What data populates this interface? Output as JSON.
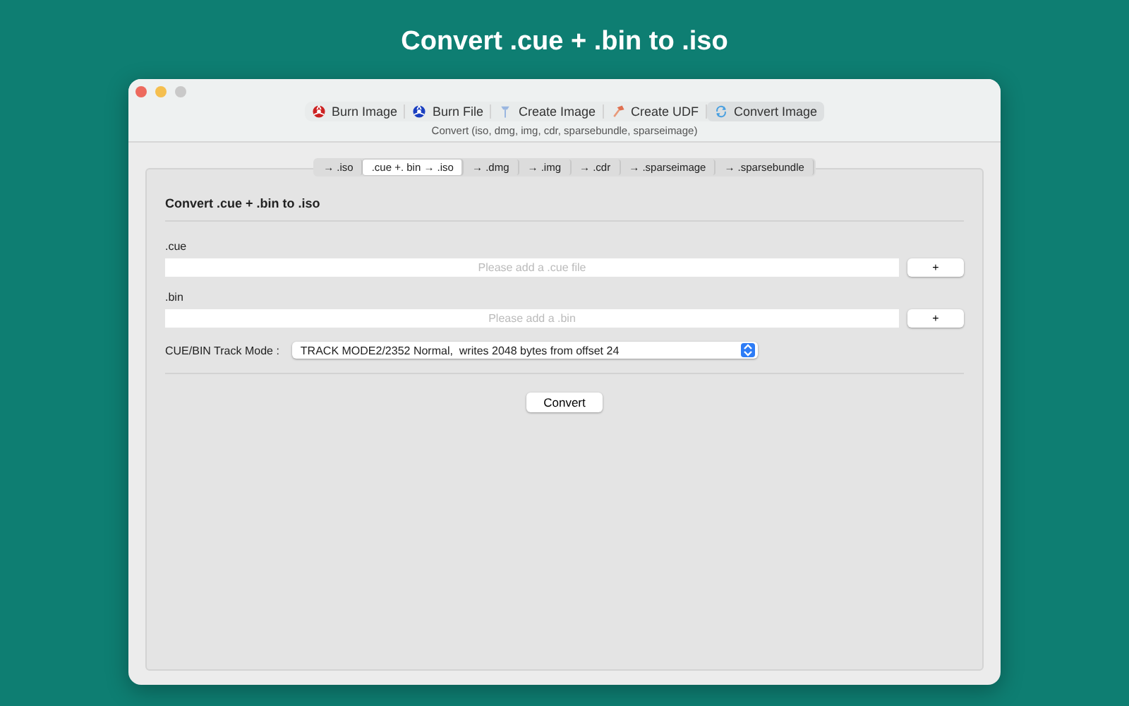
{
  "headline": "Convert .cue + .bin to .iso",
  "window": {
    "controls": [
      {
        "kind": "close"
      },
      {
        "kind": "minimize"
      },
      {
        "kind": "zoom"
      }
    ]
  },
  "toolbar": {
    "items": [
      {
        "label": "Burn Image",
        "kind": "burn-red",
        "selected": false
      },
      {
        "label": "Burn File",
        "kind": "burn-blue",
        "selected": false
      },
      {
        "label": "Create Image",
        "kind": "pin",
        "selected": false
      },
      {
        "label": "Create UDF",
        "kind": "hammer",
        "selected": false
      },
      {
        "label": "Convert Image",
        "kind": "convert",
        "selected": true
      }
    ],
    "subtitle": "Convert (iso, dmg, img, cdr, sparsebundle, sparseimage)"
  },
  "tabs": [
    {
      "label": "→ .iso",
      "selected": false
    },
    {
      "label": ".cue +. bin → .iso",
      "selected": true
    },
    {
      "label": "→ .dmg",
      "selected": false
    },
    {
      "label": "→ .img",
      "selected": false
    },
    {
      "label": "→ .cdr",
      "selected": false
    },
    {
      "label": "→ .sparseimage",
      "selected": false
    },
    {
      "label": "→ .sparsebundle",
      "selected": false
    }
  ],
  "panel": {
    "title": "Convert .cue + .bin to .iso",
    "fields": [
      {
        "label": ".cue",
        "placeholder": "Please add a .cue file",
        "button": "+"
      },
      {
        "label": ".bin",
        "placeholder": "Please add a .bin",
        "button": "+"
      }
    ],
    "track_mode": {
      "label": "CUE/BIN Track Mode :",
      "value": "TRACK MODE2/2352 Normal,  writes 2048 bytes from offset 24"
    },
    "action": "Convert"
  }
}
